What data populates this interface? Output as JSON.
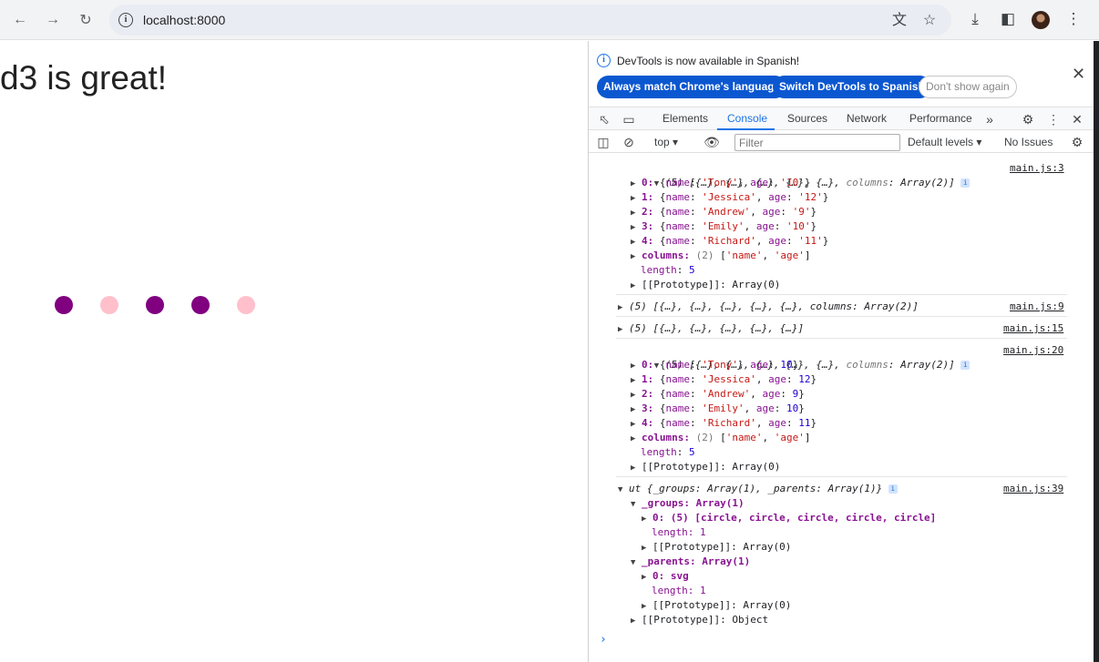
{
  "browser": {
    "url": "localhost:8000",
    "icons": [
      "back-icon",
      "forward-icon",
      "reload-icon",
      "info-icon",
      "translate-icon",
      "star-icon",
      "download-icon",
      "sidepanel-icon",
      "menu-icon"
    ]
  },
  "page": {
    "heading": "d3 is great!",
    "circles": [
      {
        "color": "#800080"
      },
      {
        "color": "#ffc0cb"
      },
      {
        "color": "#800080"
      },
      {
        "color": "#800080"
      },
      {
        "color": "#ffc0cb"
      }
    ]
  },
  "devtools": {
    "infobar": {
      "message": "DevTools is now available in Spanish!",
      "btn_match": "Always match Chrome's language",
      "btn_switch": "Switch DevTools to Spanish",
      "btn_dont": "Don't show again"
    },
    "tabs": [
      "Elements",
      "Console",
      "Sources",
      "Network",
      "Performance"
    ],
    "active_tab": "Console",
    "filterbar": {
      "context": "top",
      "filter_placeholder": "Filter",
      "levels": "Default levels",
      "issues": "No Issues"
    },
    "sources": [
      "main.js:3",
      "main.js:9",
      "main.js:15",
      "main.js:20",
      "main.js:39"
    ],
    "log1": {
      "header_pre": "(5) [{…}, {…}, {…}, {…}, {…}, ",
      "header_key": "columns",
      "header_post": ": Array(2)]",
      "rows": [
        {
          "idx": "0",
          "name": "'Tony'",
          "age": "'10'"
        },
        {
          "idx": "1",
          "name": "'Jessica'",
          "age": "'12'"
        },
        {
          "idx": "2",
          "name": "'Andrew'",
          "age": "'9'"
        },
        {
          "idx": "3",
          "name": "'Emily'",
          "age": "'10'"
        },
        {
          "idx": "4",
          "name": "'Richard'",
          "age": "'11'"
        }
      ],
      "columns_label": "columns",
      "columns_value": "(2) ['name', 'age']",
      "length_label": "length",
      "length_value": "5",
      "proto": "[[Prototype]]: Array(0)"
    },
    "log2": "(5) [{…}, {…}, {…}, {…}, {…}, columns: Array(2)]",
    "log3": "(5) [{…}, {…}, {…}, {…}, {…}]",
    "log4": {
      "rows": [
        {
          "idx": "0",
          "name": "'Tony'",
          "age": "10"
        },
        {
          "idx": "1",
          "name": "'Jessica'",
          "age": "12"
        },
        {
          "idx": "2",
          "name": "'Andrew'",
          "age": "9"
        },
        {
          "idx": "3",
          "name": "'Emily'",
          "age": "10"
        },
        {
          "idx": "4",
          "name": "'Richard'",
          "age": "11"
        }
      ]
    },
    "log5": {
      "header": "ut {_groups: Array(1), _parents: Array(1)}",
      "groups": "_groups: Array(1)",
      "groups_0": "0: (5) [circle, circle, circle, circle, circle]",
      "length": "length: 1",
      "proto_arr": "[[Prototype]]: Array(0)",
      "parents": "_parents: Array(1)",
      "parents_0": "0: svg",
      "proto_obj": "[[Prototype]]: Object"
    }
  }
}
